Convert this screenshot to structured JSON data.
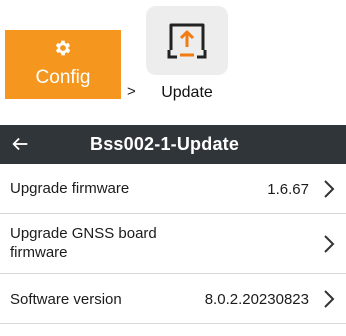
{
  "breadcrumb": {
    "config_label": "Config",
    "separator": ">",
    "update_label": "Update",
    "config_icon": "gear-icon",
    "update_icon": "upload-icon",
    "config_color": "#f5961e",
    "update_icon_color": "#f07c13"
  },
  "appbar": {
    "title": "Bss002-1-Update",
    "back_icon": "back-arrow-icon",
    "background": "#30353a"
  },
  "settings": [
    {
      "label": "Upgrade firmware",
      "value": "1.6.67"
    },
    {
      "label": "Upgrade GNSS board firmware",
      "value": ""
    },
    {
      "label": "Software version",
      "value": "8.0.2.20230823"
    }
  ]
}
